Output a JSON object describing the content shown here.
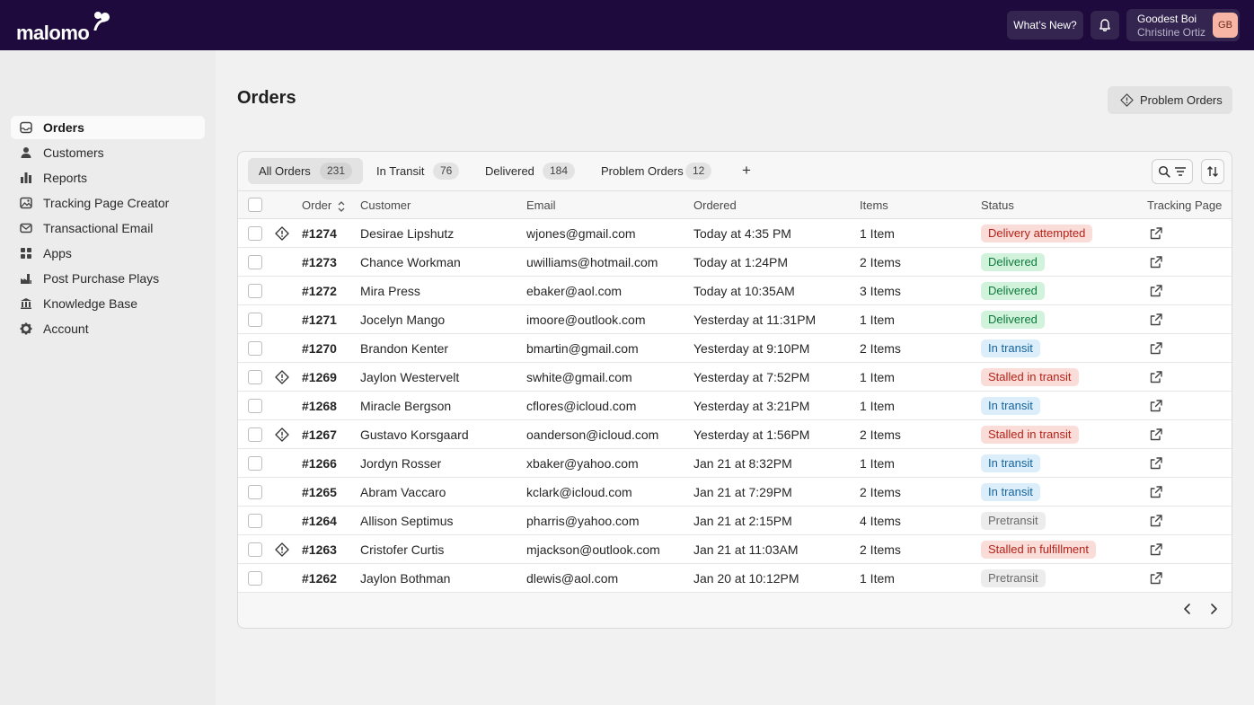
{
  "header": {
    "logo_text": "malomo",
    "whats_new_label": "What’s New?",
    "user_name": "Goodest Boi",
    "user_sub": "Christine Ortiz",
    "avatar_initials": "GB"
  },
  "sidebar": {
    "items": [
      {
        "label": "Orders",
        "icon": "inbox-icon"
      },
      {
        "label": "Customers",
        "icon": "person-icon"
      },
      {
        "label": "Reports",
        "icon": "bar-chart-icon"
      },
      {
        "label": "Tracking Page Creator",
        "icon": "image-icon"
      },
      {
        "label": "Transactional Email",
        "icon": "envelope-icon"
      },
      {
        "label": "Apps",
        "icon": "apps-icon"
      },
      {
        "label": "Post Purchase Plays",
        "icon": "factory-icon"
      },
      {
        "label": "Knowledge Base",
        "icon": "bank-icon"
      },
      {
        "label": "Account",
        "icon": "gear-icon"
      }
    ]
  },
  "main": {
    "title": "Orders",
    "problem_button_label": "Problem Orders",
    "tabs": [
      {
        "label": "All Orders",
        "count": "231"
      },
      {
        "label": "In Transit",
        "count": "76"
      },
      {
        "label": "Delivered",
        "count": "184"
      },
      {
        "label": "Problem Orders",
        "count": "12"
      }
    ],
    "add_tab_label": "+",
    "columns": [
      "Order",
      "Customer",
      "Email",
      "Ordered",
      "Items",
      "Status",
      "Tracking Page"
    ],
    "rows": [
      {
        "order": "#1274",
        "customer": "Desirae Lipshutz",
        "email": "wjones@gmail.com",
        "ordered": "Today at 4:35 PM",
        "items": "1 Item",
        "status": "Delivery attempted",
        "kind": "red",
        "problem": true
      },
      {
        "order": "#1273",
        "customer": "Chance Workman",
        "email": "uwilliams@hotmail.com",
        "ordered": "Today at 1:24PM",
        "items": "2 Items",
        "status": "Delivered",
        "kind": "green",
        "problem": false
      },
      {
        "order": "#1272",
        "customer": "Mira Press",
        "email": "ebaker@aol.com",
        "ordered": "Today at 10:35AM",
        "items": "3 Items",
        "status": "Delivered",
        "kind": "green",
        "problem": false
      },
      {
        "order": "#1271",
        "customer": "Jocelyn Mango",
        "email": "imoore@outlook.com",
        "ordered": "Yesterday at 11:31PM",
        "items": "1 Item",
        "status": "Delivered",
        "kind": "green",
        "problem": false
      },
      {
        "order": "#1270",
        "customer": "Brandon Kenter",
        "email": "bmartin@gmail.com",
        "ordered": "Yesterday at 9:10PM",
        "items": "2 Items",
        "status": "In transit",
        "kind": "blue",
        "problem": false
      },
      {
        "order": "#1269",
        "customer": "Jaylon Westervelt",
        "email": "swhite@gmail.com",
        "ordered": "Yesterday at 7:52PM",
        "items": "1 Item",
        "status": "Stalled in transit",
        "kind": "red",
        "problem": true
      },
      {
        "order": "#1268",
        "customer": "Miracle Bergson",
        "email": "cflores@icloud.com",
        "ordered": "Yesterday at 3:21PM",
        "items": "1 Item",
        "status": "In transit",
        "kind": "blue",
        "problem": false
      },
      {
        "order": "#1267",
        "customer": "Gustavo Korsgaard",
        "email": "oanderson@icloud.com",
        "ordered": "Yesterday at 1:56PM",
        "items": "2 Items",
        "status": "Stalled in transit",
        "kind": "red",
        "problem": true
      },
      {
        "order": "#1266",
        "customer": "Jordyn Rosser",
        "email": "xbaker@yahoo.com",
        "ordered": "Jan 21 at 8:32PM",
        "items": "1 Item",
        "status": "In transit",
        "kind": "blue",
        "problem": false
      },
      {
        "order": "#1265",
        "customer": "Abram Vaccaro",
        "email": "kclark@icloud.com",
        "ordered": "Jan 21 at 7:29PM",
        "items": "2 Items",
        "status": "In transit",
        "kind": "blue",
        "problem": false
      },
      {
        "order": "#1264",
        "customer": "Allison Septimus",
        "email": "pharris@yahoo.com",
        "ordered": "Jan 21 at 2:15PM",
        "items": "4 Items",
        "status": "Pretransit",
        "kind": "gray",
        "problem": false
      },
      {
        "order": "#1263",
        "customer": "Cristofer Curtis",
        "email": "mjackson@outlook.com",
        "ordered": "Jan 21 at 11:03AM",
        "items": "2 Items",
        "status": "Stalled in fulfillment",
        "kind": "red",
        "problem": true
      },
      {
        "order": "#1262",
        "customer": "Jaylon Bothman",
        "email": "dlewis@aol.com",
        "ordered": "Jan 20 at 10:12PM",
        "items": "1 Item",
        "status": "Pretransit",
        "kind": "gray",
        "problem": false
      }
    ]
  },
  "colors": {
    "topbar": "#1e0a3c",
    "status_red_text": "#b42318",
    "status_green_text": "#0e7a3a",
    "status_blue_text": "#1663a0"
  }
}
